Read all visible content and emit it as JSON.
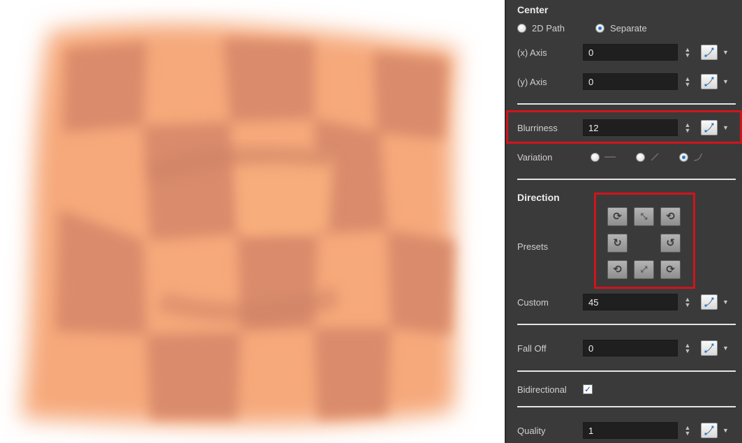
{
  "sections": {
    "center": "Center",
    "direction": "Direction"
  },
  "center_mode": {
    "options": [
      "2D Path",
      "Separate"
    ],
    "selected": "Separate"
  },
  "x_axis": {
    "label": "(x) Axis",
    "value": "0"
  },
  "y_axis": {
    "label": "(y) Axis",
    "value": "0"
  },
  "blurriness": {
    "label": "Blurriness",
    "value": "12"
  },
  "variation": {
    "label": "Variation",
    "options": [
      "straight",
      "diagonal",
      "curved"
    ],
    "selected": "curved"
  },
  "presets": {
    "label": "Presets",
    "buttons": [
      {
        "name": "rotate-cw-top-left",
        "glyph": "⟳"
      },
      {
        "name": "collapse-in",
        "glyph": "⤡"
      },
      {
        "name": "rotate-ccw-top-right",
        "glyph": "⟲"
      },
      {
        "name": "rotate-clockwise",
        "glyph": "↻"
      },
      {
        "name": "rotate-counter-clockwise",
        "glyph": "↺"
      },
      {
        "name": "rotate-ccw-bottom-left",
        "glyph": "⟲"
      },
      {
        "name": "expand-out",
        "glyph": "⤢"
      },
      {
        "name": "rotate-cw-bottom-right",
        "glyph": "⟳"
      }
    ]
  },
  "custom": {
    "label": "Custom",
    "value": "45"
  },
  "fall_off": {
    "label": "Fall Off",
    "value": "0"
  },
  "bidirectional": {
    "label": "Bidirectional",
    "checked": true,
    "mark": "✓"
  },
  "quality": {
    "label": "Quality",
    "value": "1"
  },
  "icons": {
    "spinner": "spinner-arrows-icon",
    "function": "function-curve-icon",
    "dropdown": "chevron-down-icon"
  },
  "colors": {
    "panel_bg": "#3a3a3a",
    "field_bg": "#1f1f1f",
    "highlight_red": "#d0141c",
    "canvas_tile_light": "#f6a97a",
    "canvas_tile_dark": "#d98b6c"
  }
}
